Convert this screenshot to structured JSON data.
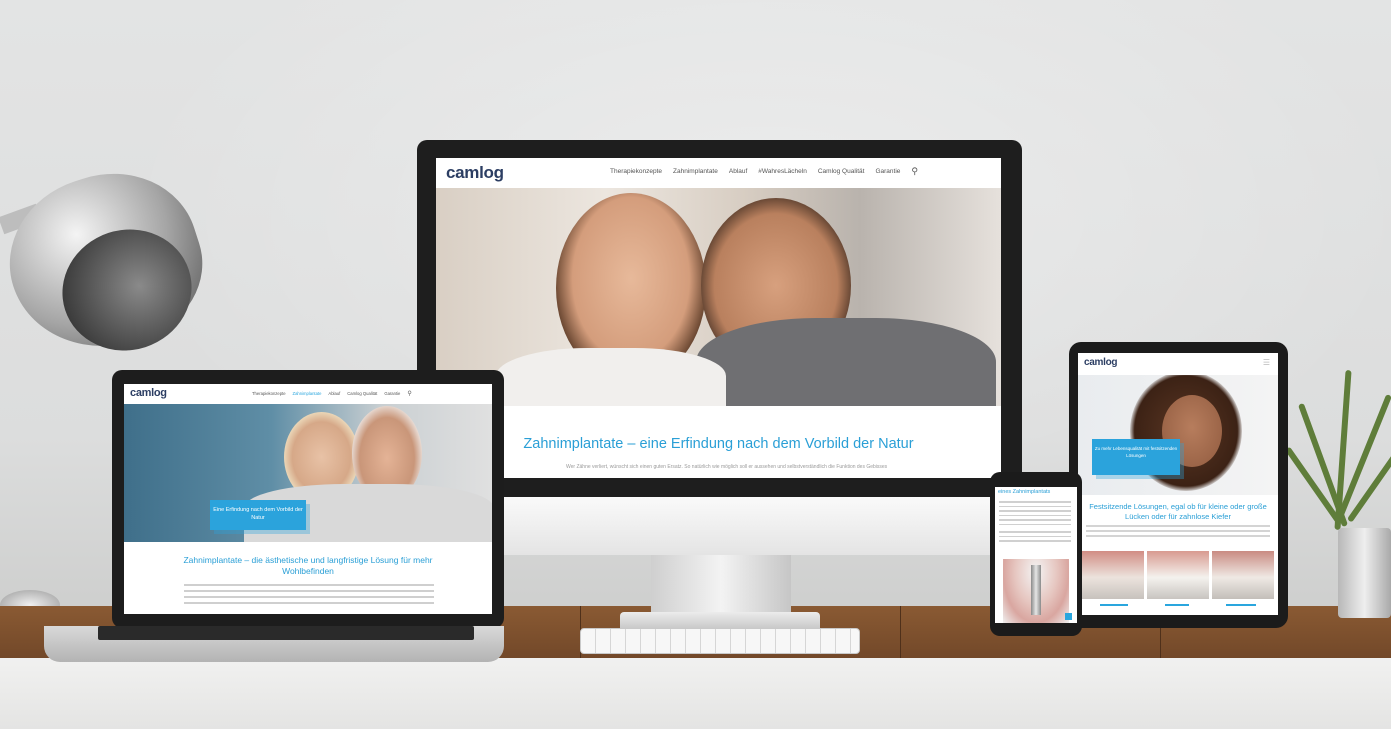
{
  "brand": "camlog",
  "desktop": {
    "nav": [
      "Therapiekonzepte",
      "Zahnimplantate",
      "Ablauf",
      "#WahresLächeln",
      "Camlog Qualität",
      "Garantie"
    ],
    "headline": "Zahnimplantate – eine Erfindung nach dem Vorbild der Natur",
    "body": "Wer Zähne verliert, wünscht sich einen guten Ersatz. So natürlich wie möglich soll er aussehen und selbstverständlich die Funktion des Gebisses"
  },
  "laptop": {
    "nav": [
      "Therapiekonzepte",
      "Zahnimplantate",
      "Ablauf",
      "Camlog Qualität",
      "Garantie"
    ],
    "cta": "Eine Erfindung nach dem Vorbild der Natur",
    "headline": "Zahnimplantate – die ästhetische und langfristige Lösung für mehr Wohlbefinden"
  },
  "tablet": {
    "cta": "Zu mehr Lebensqualität mit festsitzenden Lösungen",
    "headline": "Festsitzende Lösungen, egal ob für kleine oder große Lücken oder für zahnlose Kiefer"
  },
  "phone": {
    "headline": "eines Zahnimplantats"
  },
  "colors": {
    "accent": "#2aa6de",
    "logo": "#2c3e63"
  },
  "icons": {
    "search": "search-icon",
    "menu": "menu-icon"
  }
}
